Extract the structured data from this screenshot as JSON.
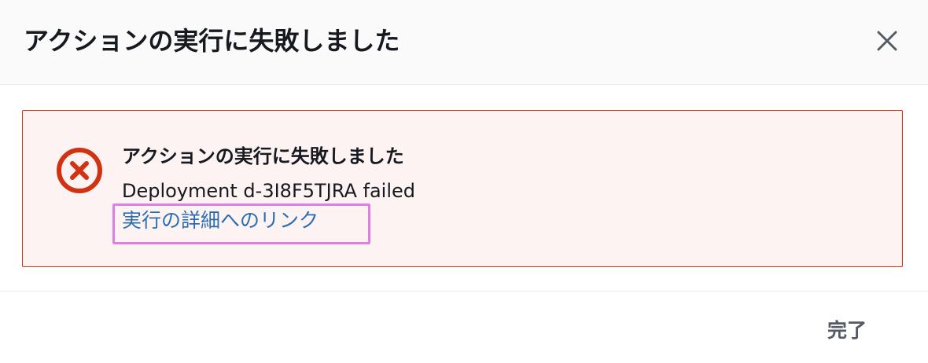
{
  "modal": {
    "title": "アクションの実行に失敗しました",
    "close_icon": "close-icon"
  },
  "alert": {
    "type": "error",
    "icon": "error-circle-x-icon",
    "title": "アクションの実行に失敗しました",
    "message": "Deployment d-3I8F5TJRA failed",
    "link_text": "実行の詳細へのリンク",
    "colors": {
      "border": "#d13212",
      "background": "#fcf3f2",
      "icon": "#d13212",
      "link": "#2a6db3",
      "highlight": "#e07ee8"
    }
  },
  "footer": {
    "done_label": "完了"
  }
}
